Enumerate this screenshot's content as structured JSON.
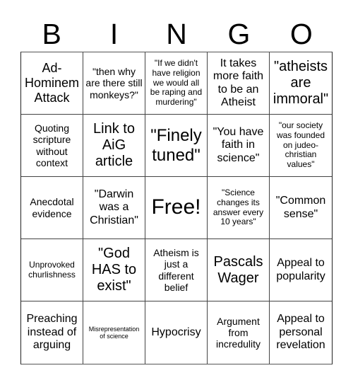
{
  "header": {
    "letters": [
      "B",
      "I",
      "N",
      "G",
      "O"
    ]
  },
  "board": {
    "cells": [
      {
        "text": "Ad-Hominem Attack",
        "size": "fs-xl"
      },
      {
        "text": "\"then why are there still monkeys?\"",
        "size": "fs-m"
      },
      {
        "text": "\"If we didn't have religion we would all be raping and murdering\"",
        "size": "fs-s"
      },
      {
        "text": "It takes more faith to be an Atheist",
        "size": "fs-l"
      },
      {
        "text": "\"atheists are immoral\"",
        "size": "fs-xxl"
      },
      {
        "text": "Quoting scripture without context",
        "size": "fs-m"
      },
      {
        "text": "Link to AiG article",
        "size": "fs-xxl"
      },
      {
        "text": "\"Finely tuned\"",
        "size": "fs-xxxl"
      },
      {
        "text": "\"You have faith in science\"",
        "size": "fs-l"
      },
      {
        "text": "\"our society was founded on judeo-christian values\"",
        "size": "fs-s"
      },
      {
        "text": "Anecdotal evidence",
        "size": "fs-m"
      },
      {
        "text": "\"Darwin was a Christian\"",
        "size": "fs-l"
      },
      {
        "text": "Free!",
        "size": "fs-free"
      },
      {
        "text": "\"Science changes its answer every 10 years\"",
        "size": "fs-s"
      },
      {
        "text": "\"Common sense\"",
        "size": "fs-l"
      },
      {
        "text": "Unprovoked churlishness",
        "size": "fs-s"
      },
      {
        "text": "\"God HAS to exist\"",
        "size": "fs-xxl"
      },
      {
        "text": "Atheism is just a different belief",
        "size": "fs-m"
      },
      {
        "text": "Pascals Wager",
        "size": "fs-xxl"
      },
      {
        "text": "Appeal to popularity",
        "size": "fs-l"
      },
      {
        "text": "Preaching instead of arguing",
        "size": "fs-l"
      },
      {
        "text": "Misrepresentation of science",
        "size": "fs-xs"
      },
      {
        "text": "Hypocrisy",
        "size": "fs-l"
      },
      {
        "text": "Argument from incredulity",
        "size": "fs-m"
      },
      {
        "text": "Appeal to personal revelation",
        "size": "fs-l"
      }
    ]
  }
}
